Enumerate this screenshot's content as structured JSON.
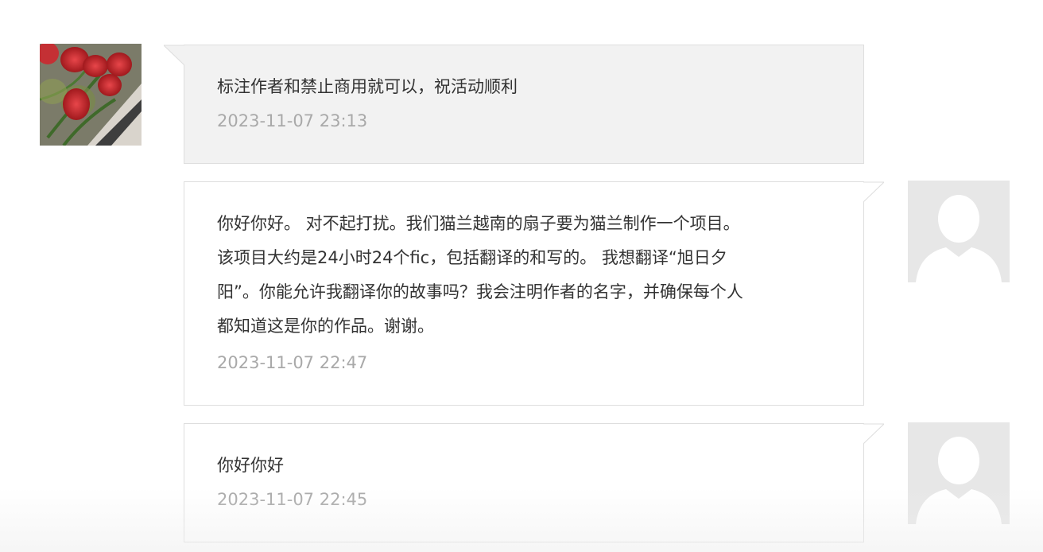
{
  "messages": [
    {
      "side": "received",
      "text": "标注作者和禁止商用就可以，祝活动顺利",
      "timestamp": "2023-11-07 23:13",
      "avatar": "rose-photo"
    },
    {
      "side": "sent",
      "text": "你好你好。 对不起打扰。我们猫兰越南的扇子要为猫兰制作一个项目。\n该项目大约是24小时24个fic，包括翻译的和写的。 我想翻译“旭日夕\n阳”。你能允许我翻译你的故事吗？我会注明作者的名字，并确保每个人\n都知道这是你的作品。谢谢。",
      "timestamp": "2023-11-07 22:47",
      "avatar": "default-user-silhouette"
    },
    {
      "side": "sent",
      "text": "你好你好",
      "timestamp": "2023-11-07 22:45",
      "avatar": "default-user-silhouette"
    }
  ],
  "colors": {
    "received_bubble_bg": "#f2f2f2",
    "sent_bubble_bg": "#ffffff",
    "bubble_border": "#dedede",
    "message_text": "#333333",
    "timestamp_text": "#a9a9a9",
    "placeholder_avatar_bg": "#e7e7e7",
    "placeholder_avatar_fg": "#ffffff"
  }
}
